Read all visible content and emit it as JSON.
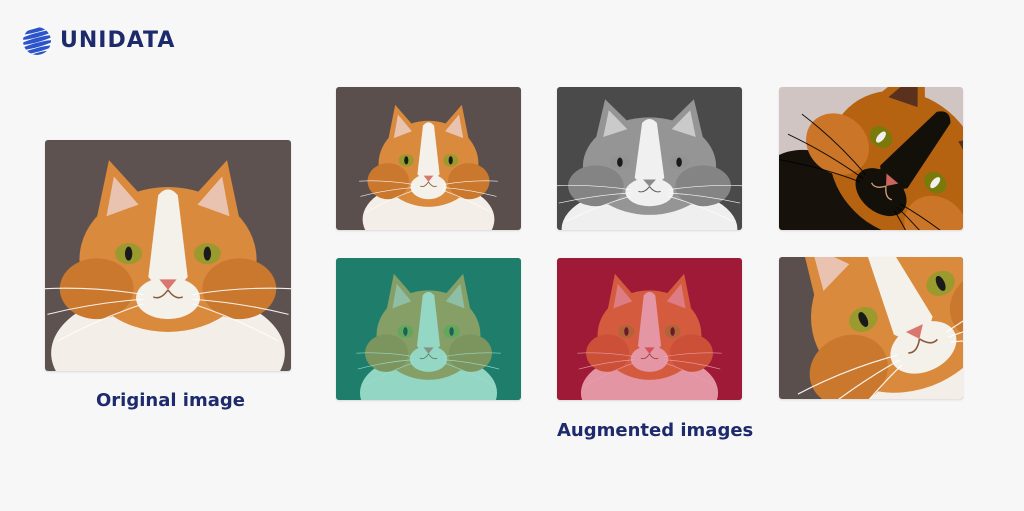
{
  "brand": {
    "name": "UNIDATA",
    "color": "#1d2a6b"
  },
  "captions": {
    "original": "Original image",
    "augmented": "Augmented images"
  },
  "images": {
    "original": {
      "subject": "orange-white cat photo"
    },
    "augmented": [
      {
        "subject": "cat photo, downscaled"
      },
      {
        "subject": "cat photo, grayscale"
      },
      {
        "subject": "cat photo, rotated, inverted colors"
      },
      {
        "subject": "cat photo, teal color tint"
      },
      {
        "subject": "cat photo, red color tint"
      },
      {
        "subject": "cat photo, rotated and zoomed"
      }
    ]
  }
}
